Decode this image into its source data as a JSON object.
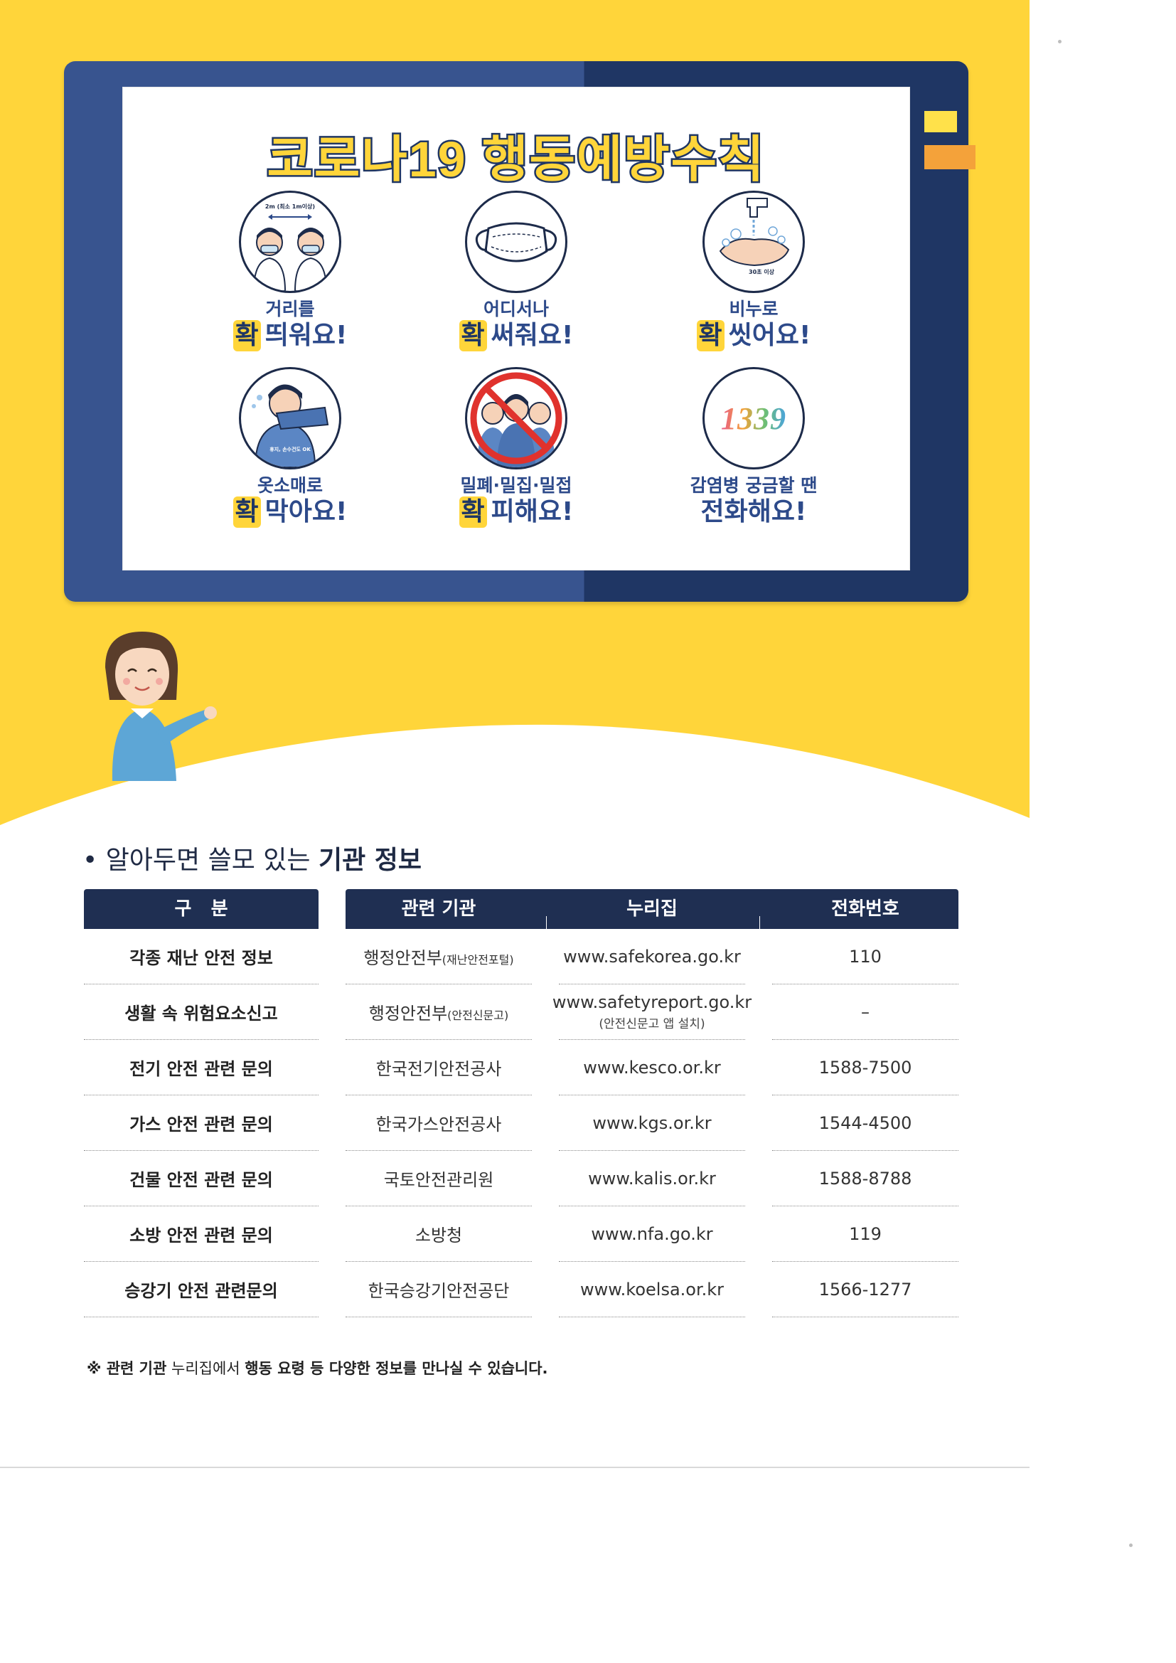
{
  "poster": {
    "title": "코로나19 행동예방수칙",
    "hwak": "확",
    "rules": [
      {
        "caption": "거리를",
        "action": "띄워요!",
        "icon": "distance-icon",
        "icon_text": "2m (최소 1m이상)"
      },
      {
        "caption": "어디서나",
        "action": "써줘요!",
        "icon": "mask-icon",
        "icon_text": ""
      },
      {
        "caption": "비누로",
        "action": "씻어요!",
        "icon": "handwash-icon",
        "icon_text": "30초 이상"
      },
      {
        "caption": "옷소매로",
        "action": "막아요!",
        "icon": "cough-icon",
        "icon_text": "휴지, 손수건도 OK"
      },
      {
        "caption": "밀폐·밀집·밀접",
        "action": "피해요!",
        "icon": "no-crowd-icon",
        "icon_text": ""
      },
      {
        "caption": "감염병 궁금할 땐",
        "action": "전화해요!",
        "icon": "hotline-1339-icon",
        "icon_text": "1339"
      }
    ]
  },
  "info": {
    "bullet": "•",
    "title_normal": "알아두면 쓸모 있는",
    "title_bold": "기관 정보",
    "headers": {
      "category": "구   분",
      "org": "관련 기관",
      "website": "누리집",
      "phone": "전화번호"
    },
    "rows": [
      {
        "category": "각종 재난 안전 정보",
        "org": "행정안전부",
        "org_sub": "(재난안전포털)",
        "website": "www.safekorea.go.kr",
        "website_sub": "",
        "phone": "110"
      },
      {
        "category": "생활 속 위험요소신고",
        "org": "행정안전부",
        "org_sub": "(안전신문고)",
        "website": "www.safetyreport.go.kr",
        "website_sub": "(안전신문고 앱 설치)",
        "phone": "–"
      },
      {
        "category": "전기 안전 관련 문의",
        "org": "한국전기안전공사",
        "org_sub": "",
        "website": "www.kesco.or.kr",
        "website_sub": "",
        "phone": "1588-7500"
      },
      {
        "category": "가스 안전 관련 문의",
        "org": "한국가스안전공사",
        "org_sub": "",
        "website": "www.kgs.or.kr",
        "website_sub": "",
        "phone": "1544-4500"
      },
      {
        "category": "건물 안전 관련 문의",
        "org": "국토안전관리원",
        "org_sub": "",
        "website": "www.kalis.or.kr",
        "website_sub": "",
        "phone": "1588-8788"
      },
      {
        "category": "소방 안전 관련 문의",
        "org": "소방청",
        "org_sub": "",
        "website": "www.nfa.go.kr",
        "website_sub": "",
        "phone": "119"
      },
      {
        "category": "승강기 안전 관련문의",
        "org": "한국승강기안전공단",
        "org_sub": "",
        "website": "www.koelsa.or.kr",
        "website_sub": "",
        "phone": "1566-1277"
      }
    ],
    "footnote_prefix": "※ 관련 기관",
    "footnote_mid": " 누리집에서 ",
    "footnote_suffix": "행동 요령 등 다양한 정보를 만나실 수 있습니다."
  },
  "colors": {
    "yellow": "#ffd53a",
    "navy": "#1f2f52",
    "blue": "#2d4a8a"
  }
}
